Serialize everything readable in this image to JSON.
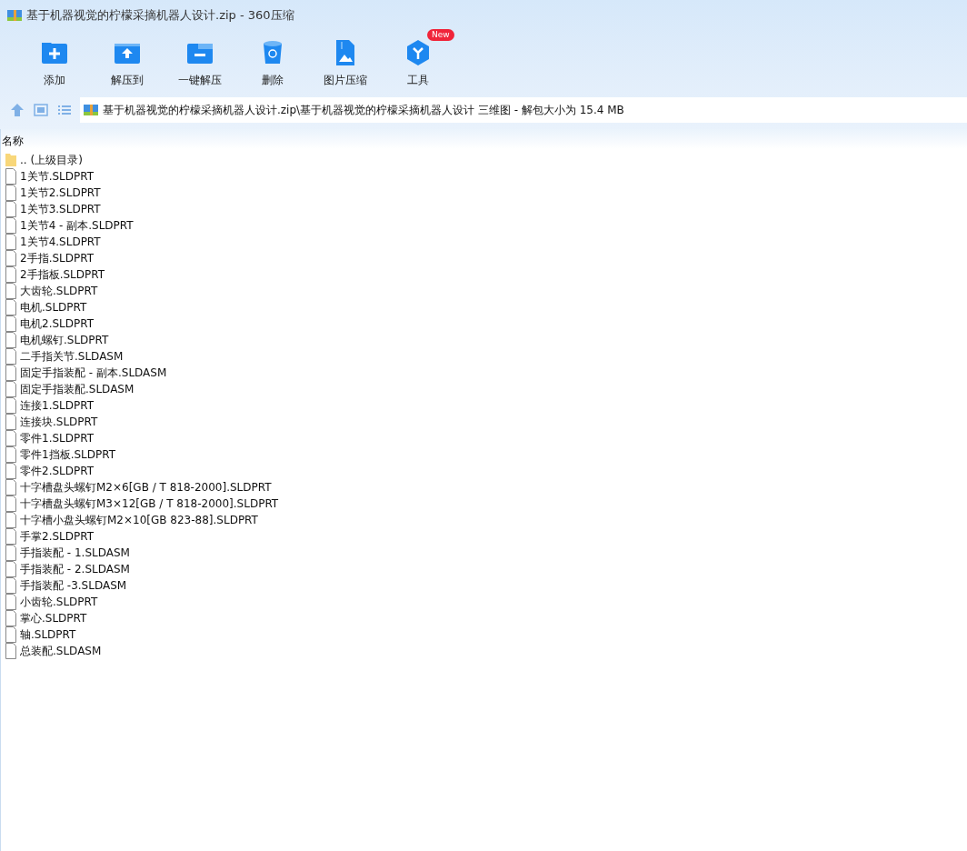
{
  "window": {
    "title": "基于机器视觉的柠檬采摘机器人设计.zip - 360压缩"
  },
  "toolbar": [
    {
      "label": "添加",
      "kind": "add"
    },
    {
      "label": "解压到",
      "kind": "extract"
    },
    {
      "label": "一键解压",
      "kind": "oneclick"
    },
    {
      "label": "删除",
      "kind": "delete"
    },
    {
      "label": "图片压缩",
      "kind": "image"
    },
    {
      "label": "工具",
      "kind": "tools",
      "badge": "New"
    }
  ],
  "address": {
    "path": "基于机器视觉的柠檬采摘机器人设计.zip\\基于机器视觉的柠檬采摘机器人设计 三维图 - 解包大小为 15.4 MB"
  },
  "table": {
    "columns": [
      "名称"
    ],
    "rows": [
      {
        "name": ".. (上级目录)",
        "kind": "folder"
      },
      {
        "name": "1关节.SLDPRT",
        "kind": "file"
      },
      {
        "name": "1关节2.SLDPRT",
        "kind": "file"
      },
      {
        "name": "1关节3.SLDPRT",
        "kind": "file"
      },
      {
        "name": "1关节4 - 副本.SLDPRT",
        "kind": "file"
      },
      {
        "name": "1关节4.SLDPRT",
        "kind": "file"
      },
      {
        "name": "2手指.SLDPRT",
        "kind": "file"
      },
      {
        "name": "2手指板.SLDPRT",
        "kind": "file"
      },
      {
        "name": "大齿轮.SLDPRT",
        "kind": "file"
      },
      {
        "name": "电机.SLDPRT",
        "kind": "file"
      },
      {
        "name": "电机2.SLDPRT",
        "kind": "file"
      },
      {
        "name": "电机螺钉.SLDPRT",
        "kind": "file"
      },
      {
        "name": "二手指关节.SLDASM",
        "kind": "file"
      },
      {
        "name": "固定手指装配 - 副本.SLDASM",
        "kind": "file"
      },
      {
        "name": "固定手指装配.SLDASM",
        "kind": "file"
      },
      {
        "name": "连接1.SLDPRT",
        "kind": "file"
      },
      {
        "name": "连接块.SLDPRT",
        "kind": "file"
      },
      {
        "name": "零件1.SLDPRT",
        "kind": "file"
      },
      {
        "name": "零件1挡板.SLDPRT",
        "kind": "file"
      },
      {
        "name": "零件2.SLDPRT",
        "kind": "file"
      },
      {
        "name": "十字槽盘头螺钉M2×6[GB / T 818-2000].SLDPRT",
        "kind": "file"
      },
      {
        "name": "十字槽盘头螺钉M3×12[GB / T 818-2000].SLDPRT",
        "kind": "file"
      },
      {
        "name": "十字槽小盘头螺钉M2×10[GB 823-88].SLDPRT",
        "kind": "file"
      },
      {
        "name": "手掌2.SLDPRT",
        "kind": "file"
      },
      {
        "name": "手指装配 - 1.SLDASM",
        "kind": "file"
      },
      {
        "name": "手指装配 - 2.SLDASM",
        "kind": "file"
      },
      {
        "name": "手指装配 -3.SLDASM",
        "kind": "file"
      },
      {
        "name": "小齿轮.SLDPRT",
        "kind": "file"
      },
      {
        "name": "掌心.SLDPRT",
        "kind": "file"
      },
      {
        "name": "轴.SLDPRT",
        "kind": "file"
      },
      {
        "name": "总装配.SLDASM",
        "kind": "file"
      }
    ]
  }
}
